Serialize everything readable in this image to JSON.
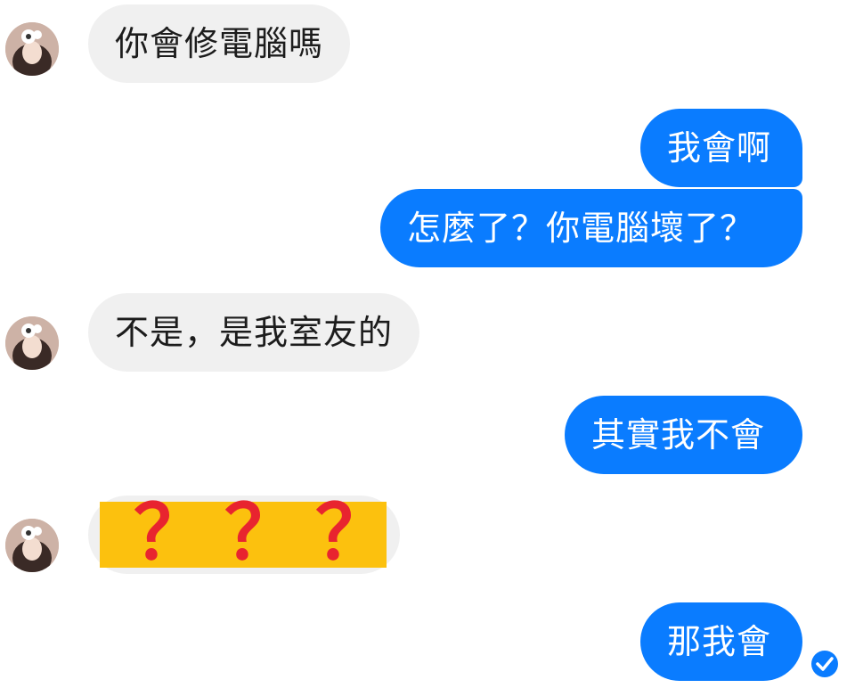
{
  "messages": {
    "m1": "你會修電腦嗎",
    "m2": "我會啊",
    "m3": "怎麼了？你電腦壞了？",
    "m4": "不是，是我室友的",
    "m5": "其實我不會",
    "m6_marks": [
      "？",
      "？",
      "？"
    ],
    "m7": "那我會"
  },
  "colors": {
    "outgoing_bubble": "#0a7cff",
    "incoming_bubble": "#f0f0f0",
    "censor_box": "#fcc10e",
    "question_marks": "#e8242f"
  },
  "icons": {
    "avatar": "avatar-icon",
    "seen": "seen-check-icon"
  }
}
